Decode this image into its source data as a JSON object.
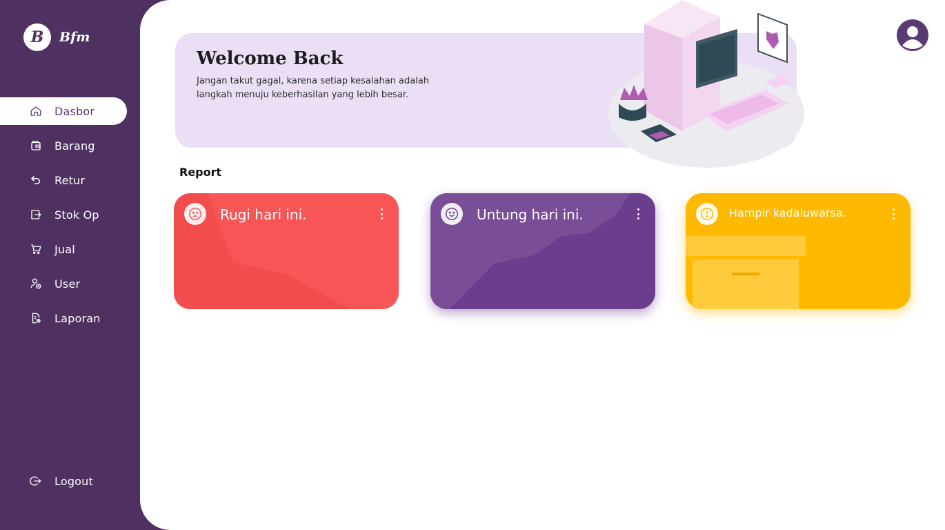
{
  "brand": {
    "mark": "B",
    "name": "Bfm"
  },
  "nav": {
    "items": [
      {
        "label": "Dasbor",
        "icon": "home-icon",
        "active": true
      },
      {
        "label": "Barang",
        "icon": "wallet-icon"
      },
      {
        "label": "Retur",
        "icon": "return-icon"
      },
      {
        "label": "Stok Op",
        "icon": "export-icon"
      },
      {
        "label": "Jual",
        "icon": "cart-icon"
      },
      {
        "label": "User",
        "icon": "user-add-icon"
      },
      {
        "label": "Laporan",
        "icon": "report-icon"
      }
    ],
    "logout": {
      "label": "Logout",
      "icon": "logout-icon"
    }
  },
  "banner": {
    "title": "Welcome Back",
    "subtitle": "Jangan takut gagal, karena setiap kesalahan adalah langkah menuju keberhasilan yang lebih besar."
  },
  "report": {
    "title": "Report",
    "cards": [
      {
        "title": "Rugi hari ini.",
        "icon": "sad-face-icon",
        "color": "#f85557"
      },
      {
        "title": "Untung hari ini.",
        "icon": "smile-face-icon",
        "color": "#6a3d8e"
      },
      {
        "title": "Hampir kadaluwarsa.",
        "icon": "warning-icon",
        "color": "#ffb900"
      }
    ]
  },
  "colors": {
    "sidebar": "#4e3160",
    "banner": "#ebdff6",
    "accent": "#5a3a72"
  }
}
